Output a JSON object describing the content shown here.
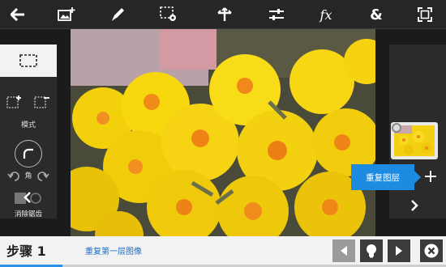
{
  "toolbar": {
    "items": [
      {
        "name": "back-arrow-icon"
      },
      {
        "name": "add-image-icon"
      },
      {
        "name": "brush-icon"
      },
      {
        "name": "selection-settings-icon"
      },
      {
        "name": "transform-icon"
      },
      {
        "name": "adjustments-icon"
      },
      {
        "name": "effects-icon",
        "label": "fx"
      },
      {
        "name": "blend-icon",
        "label": "&"
      },
      {
        "name": "fullscreen-icon"
      }
    ]
  },
  "left_panel": {
    "mode_label": "模式",
    "corner_label": "角",
    "clear_label": "消除锯齿"
  },
  "right_panel": {
    "duplicate_layer_label": "重复图层",
    "add_label": "+"
  },
  "bottom": {
    "step_label": "步骤 1",
    "step_description": "重复第一层图像",
    "progress": 0.14
  },
  "colors": {
    "accent": "#1d8be0",
    "toolbar_bg": "#262626",
    "bottom_bg": "#f2f2f2"
  }
}
